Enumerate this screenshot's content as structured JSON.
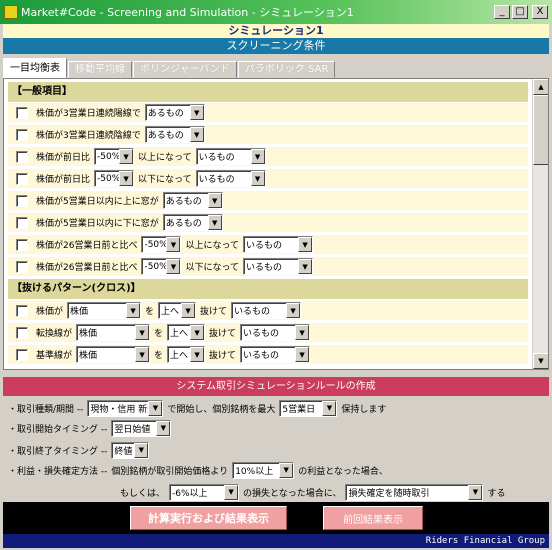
{
  "window": {
    "title": "Market#Code - Screening and Simulation -    シミュレーション1",
    "minimize": "_",
    "maximize": "□",
    "close": "X"
  },
  "header": {
    "simulation_title": "シミュレーション1",
    "screening_title": "スクリーニング条件"
  },
  "tabs": [
    "一目均衡表",
    "移動平均線",
    "ボリンジャーバンド",
    "パラボリック SAR"
  ],
  "sections": {
    "general": "【一般項目】",
    "cross": "【抜けるパターン(クロス)】"
  },
  "general_rows": [
    {
      "a": "株価が3営業日連続陽線で",
      "s1": "あるもの"
    },
    {
      "a": "株価が3営業日連続陰線で",
      "s1": "あるもの"
    },
    {
      "a": "株価が前日比",
      "s1": "-50%",
      "b": "以上になって",
      "s2": "いるもの"
    },
    {
      "a": "株価が前日比",
      "s1": "-50%",
      "b": "以下になって",
      "s2": "いるもの"
    },
    {
      "a": "株価が5営業日以内に上に窓が",
      "s1": "あるもの"
    },
    {
      "a": "株価が5営業日以内に下に窓が",
      "s1": "あるもの"
    },
    {
      "a": "株価が26営業日前と比べ",
      "s1": "-50%",
      "b": "以上になって",
      "s2": "いるもの"
    },
    {
      "a": "株価が26営業日前と比べ",
      "s1": "-50%",
      "b": "以下になって",
      "s2": "いるもの"
    }
  ],
  "cross_rows": [
    {
      "a": "株価が",
      "s1": "株価",
      "b": "を",
      "s2": "上へ",
      "c": "抜けて",
      "s3": "いるもの"
    },
    {
      "a": "転換線が",
      "s1": "株価",
      "b": "を",
      "s2": "上へ",
      "c": "抜けて",
      "s3": "いるもの"
    },
    {
      "a": "基準線が",
      "s1": "株価",
      "b": "を",
      "s2": "上へ",
      "c": "抜けて",
      "s3": "いるもの"
    }
  ],
  "system": {
    "header": "システム取引シミュレーションルールの作成",
    "trade_type": {
      "label": "・取引種類/期間 --",
      "value": "現物・信用 新規買",
      "mid": "で開始し、個別銘柄を最大",
      "days": "5営業日",
      "tail": "保持します"
    },
    "start_timing": {
      "label": "・取引開始タイミング --",
      "value": "翌日始値"
    },
    "end_timing": {
      "label": "・取引終了タイミング --",
      "value": "終値"
    },
    "profit": {
      "label": "・利益・損失確定方法 --",
      "mid": "個別銘柄が取引開始価格より",
      "value": "10%以上",
      "tail": "の利益となった場合、"
    },
    "loss": {
      "head": "もしくは、",
      "value": "-6%以上",
      "mid": "の損失となった場合に、",
      "method": "損失確定を随時取引",
      "tail": "する"
    }
  },
  "buttons": {
    "execute": "計算実行および結果表示",
    "previous": "前回結果表示"
  },
  "footer": "Riders Financial Group"
}
